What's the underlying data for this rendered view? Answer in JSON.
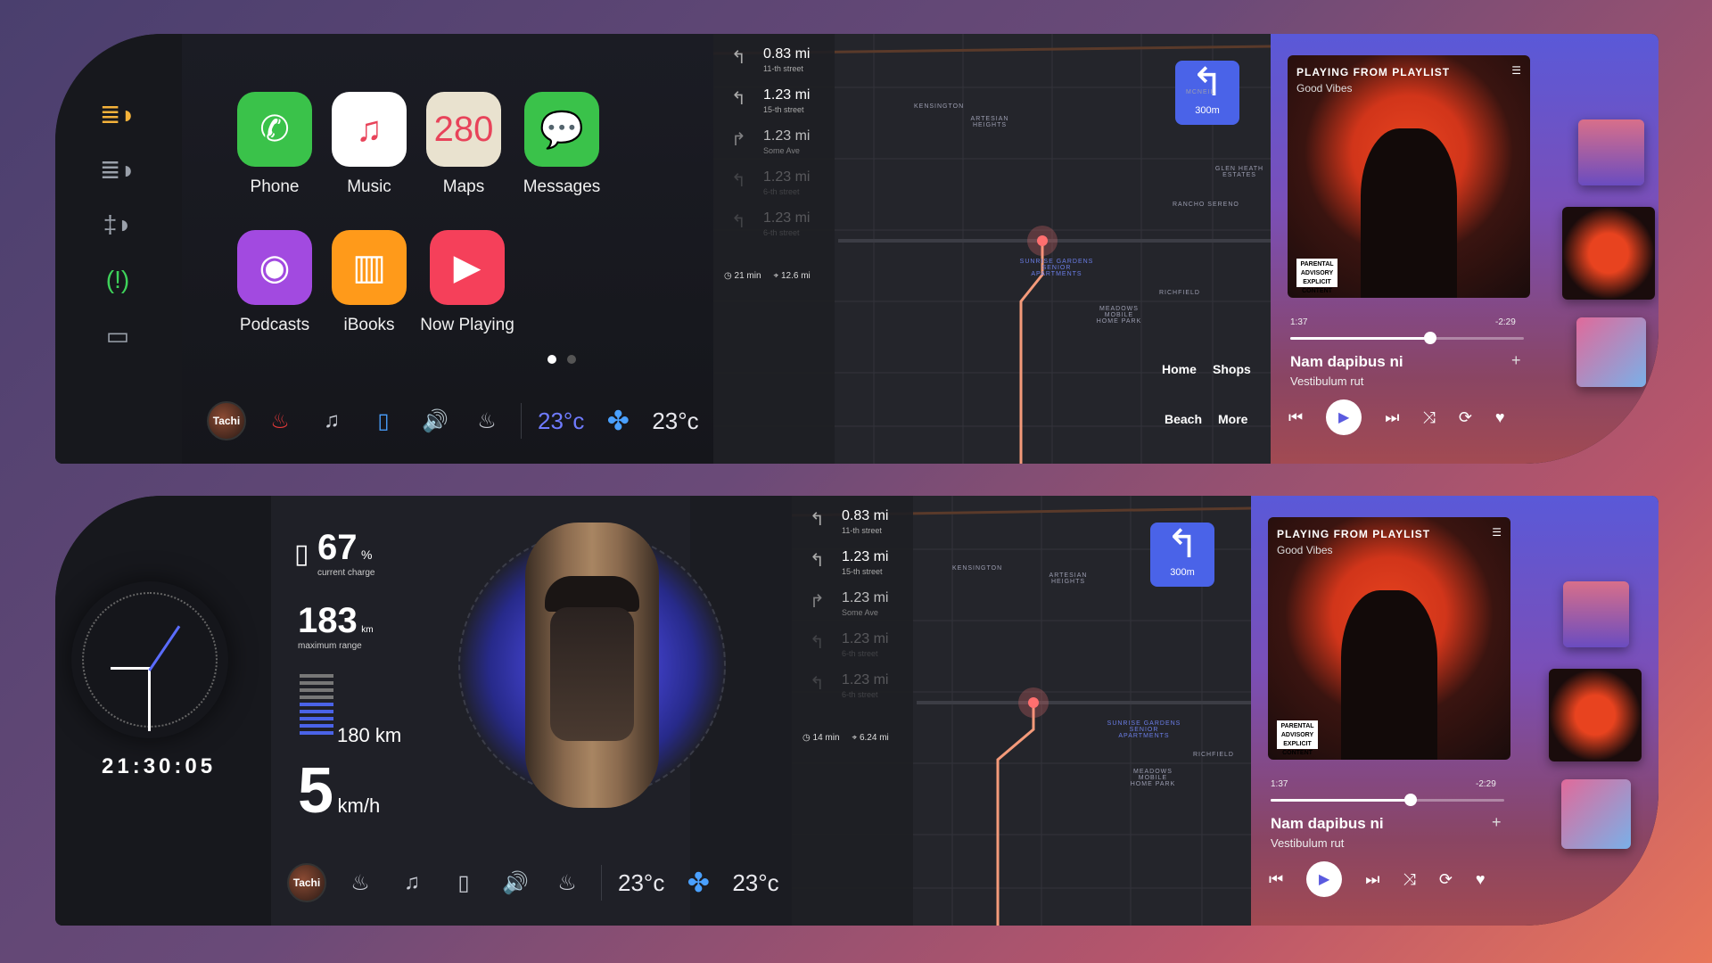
{
  "apps": [
    {
      "label": "Phone",
      "icon": "phone-icon",
      "bg": "#3ac24a",
      "glyph": "✆"
    },
    {
      "label": "Music",
      "icon": "music-icon",
      "bg": "#ffffff",
      "glyph": "♫"
    },
    {
      "label": "Maps",
      "icon": "maps-icon",
      "bg": "#e9e2cf",
      "glyph": "280"
    },
    {
      "label": "Messages",
      "icon": "messages-icon",
      "bg": "#3ac24a",
      "glyph": "💬"
    },
    {
      "label": "Podcasts",
      "icon": "podcasts-icon",
      "bg": "#a24ae0",
      "glyph": "◉"
    },
    {
      "label": "iBooks",
      "icon": "ibooks-icon",
      "bg": "#ff9a1a",
      "glyph": "▥"
    },
    {
      "label": "Now Playing",
      "icon": "now-playing-icon",
      "bg": "#f5405a",
      "glyph": "▶"
    }
  ],
  "bar": {
    "avatar": "Tachi",
    "temp_left": "23°c",
    "temp_right": "23°c"
  },
  "route_top": {
    "steps": [
      {
        "dist": "0.83 mi",
        "street": "11-th street"
      },
      {
        "dist": "1.23 mi",
        "street": "15-th street"
      },
      {
        "dist": "1.23 mi",
        "street": "Some Ave"
      },
      {
        "dist": "1.23 mi",
        "street": "6-th street"
      },
      {
        "dist": "1.23 mi",
        "street": "6-th street"
      }
    ],
    "eta_time": "21 min",
    "eta_dist": "12.6 mi",
    "turn_dist": "300m"
  },
  "route_bottom": {
    "steps": [
      {
        "dist": "0.83 mi",
        "street": "11-th street"
      },
      {
        "dist": "1.23 mi",
        "street": "15-th street"
      },
      {
        "dist": "1.23 mi",
        "street": "Some Ave"
      },
      {
        "dist": "1.23 mi",
        "street": "6-th street"
      },
      {
        "dist": "1.23 mi",
        "street": "6-th street"
      }
    ],
    "eta_time": "14 min",
    "eta_dist": "6.24 mi",
    "turn_dist": "300m"
  },
  "map": {
    "places": [
      "KENSINGTON",
      "ARTESIAN HEIGHTS",
      "SUNRISE GARDENS SENIOR APARTMENTS",
      "MEADOWS MOBILE HOME PARK",
      "RICHFIELD",
      "RANCHO SERENO",
      "GLEN HEATH ESTATES",
      "MCNEIL"
    ],
    "quick": [
      "Home",
      "Shops",
      "Beach",
      "More"
    ]
  },
  "music": {
    "header": "PLAYING FROM PLAYLIST",
    "playlist": "Good Vibes",
    "elapsed": "1:37",
    "remaining": "-2:29",
    "progress": 0.6,
    "song": "Nam dapibus ni",
    "artist": "Vestibulum rut",
    "advisory": "PARENTAL ADVISORY EXPLICIT CONTENT"
  },
  "stats": {
    "charge": "67",
    "charge_unit": "%",
    "charge_label": "current charge",
    "range": "183",
    "range_unit": "km",
    "range_label": "maximum range",
    "km": "180 km",
    "speed": "5",
    "speed_unit": "km/h",
    "clock": "21:30:05"
  }
}
